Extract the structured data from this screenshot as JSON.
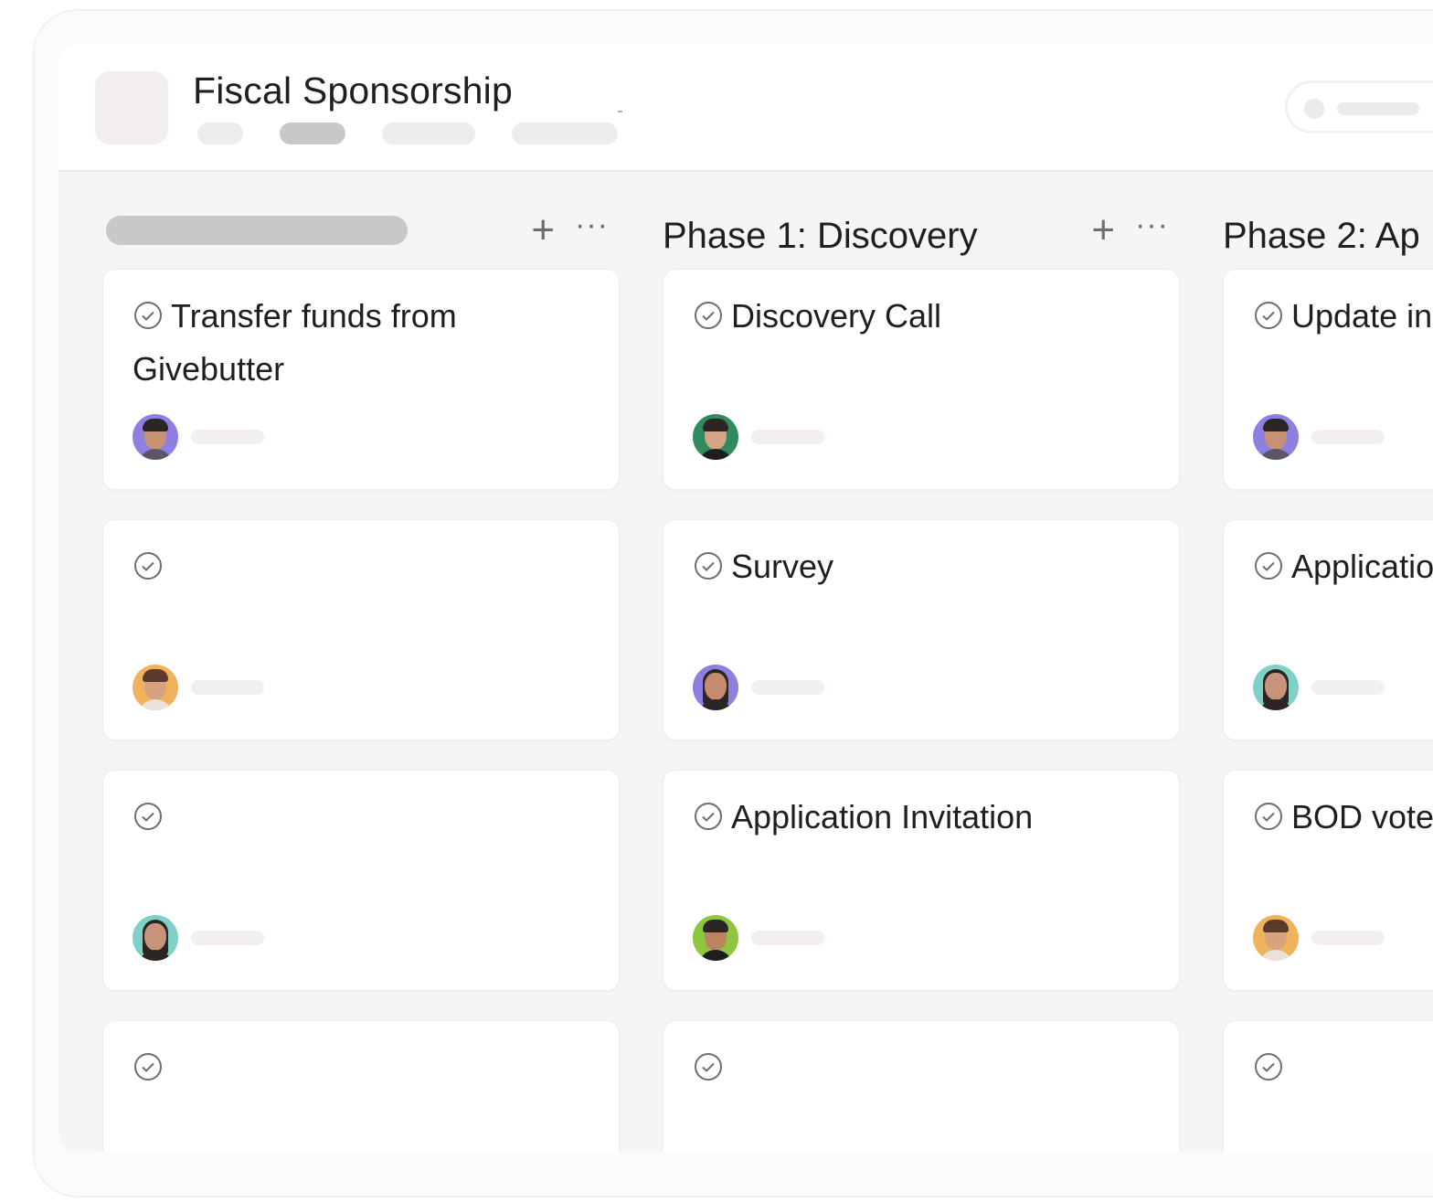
{
  "project": {
    "title": "Fiscal Sponsorship"
  },
  "columns": [
    {
      "title": "",
      "add_label": "+",
      "more_label": "···",
      "cards": [
        {
          "title": "Transfer funds from Givebutter",
          "assignee_color": "#8f7fe0"
        },
        {
          "title": "",
          "assignee_color": "#f1b25c"
        },
        {
          "title": "",
          "assignee_color": "#7fd0c8"
        },
        {
          "title": ""
        }
      ]
    },
    {
      "title": "Phase 1: Discovery",
      "add_label": "+",
      "more_label": "···",
      "cards": [
        {
          "title": "Discovery Call",
          "assignee_color": "#2f8a5e"
        },
        {
          "title": "Survey",
          "assignee_color": "#8f7fe0"
        },
        {
          "title": "Application Invitation",
          "assignee_color": "#8fc63f"
        },
        {
          "title": ""
        }
      ]
    },
    {
      "title": "Phase 2: Ap",
      "cards": [
        {
          "title": "Update in",
          "assignee_color": "#8f7fe0"
        },
        {
          "title": "Applicatio",
          "assignee_color": "#7fd0c8"
        },
        {
          "title": "BOD vote approval/de",
          "assignee_color": "#f1b25c"
        },
        {
          "title": ""
        }
      ]
    }
  ],
  "icons": {
    "check": "check-circle-icon",
    "add": "plus-icon",
    "more": "more-icon",
    "avatar": "avatar"
  },
  "colors": {
    "board_bg": "#f5f5f5",
    "card_bg": "#ffffff",
    "skeleton": "#c9c7c7",
    "skeleton_light": "#eeeded"
  }
}
